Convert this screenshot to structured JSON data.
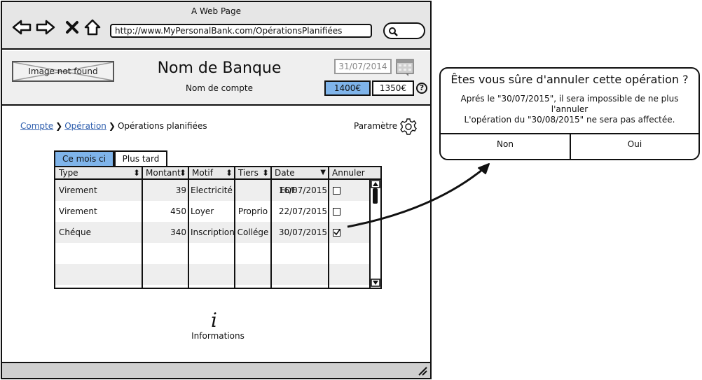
{
  "window": {
    "title": "A Web Page"
  },
  "addressbar": {
    "url": "http://www.MyPersonalBank.com/OpérationsPlanifiées"
  },
  "header": {
    "image_placeholder": "Image not found",
    "bank_name": "Nom de Banque",
    "account_name": "Nom de compte",
    "date": "31/07/2014",
    "balance_primary": "1400€",
    "balance_secondary": "1350€",
    "help": "?"
  },
  "breadcrumb": {
    "items": [
      {
        "label": "Compte"
      },
      {
        "label": "Opération"
      }
    ],
    "current": "Opérations planifiées",
    "separator": "❯"
  },
  "settings": {
    "label": "Paramètre"
  },
  "tabs": [
    {
      "label": "Ce mois ci",
      "active": true
    },
    {
      "label": "Plus tard",
      "active": false
    }
  ],
  "table": {
    "columns": [
      {
        "label": "Type",
        "sort": "⬍"
      },
      {
        "label": "Montant",
        "sort": "⬍"
      },
      {
        "label": "Motif",
        "sort": "⬍"
      },
      {
        "label": "Tiers",
        "sort": "⬍"
      },
      {
        "label": "Date",
        "sort": "▼"
      },
      {
        "label": "Annuler",
        "sort": ""
      }
    ],
    "rows": [
      {
        "type": "Virement",
        "montant": "39",
        "motif": "Electricité",
        "tiers": "EDF",
        "date": "16/07/2015",
        "annuler": false
      },
      {
        "type": "Virement",
        "montant": "450",
        "motif": "Loyer",
        "tiers": "Proprio",
        "date": "22/07/2015",
        "annuler": false
      },
      {
        "type": "Chéque",
        "montant": "340",
        "motif": "Inscription",
        "tiers": "Collége",
        "date": "30/07/2015",
        "annuler": true
      }
    ]
  },
  "info": {
    "icon": "i",
    "label": "Informations"
  },
  "dialog": {
    "title": "Êtes vous sûre d'annuler cette opération ?",
    "line1": "Aprés le \"30/07/2015\", il sera impossible de ne plus",
    "line2": "l'annuler",
    "line3": "L'opération du \"30/08/2015\" ne sera pas affectée.",
    "no_label": "Non",
    "yes_label": "Oui"
  },
  "colors": {
    "accent": "#7fb4ea",
    "link": "#2f5fae",
    "chrome": "#e6e6e6"
  }
}
